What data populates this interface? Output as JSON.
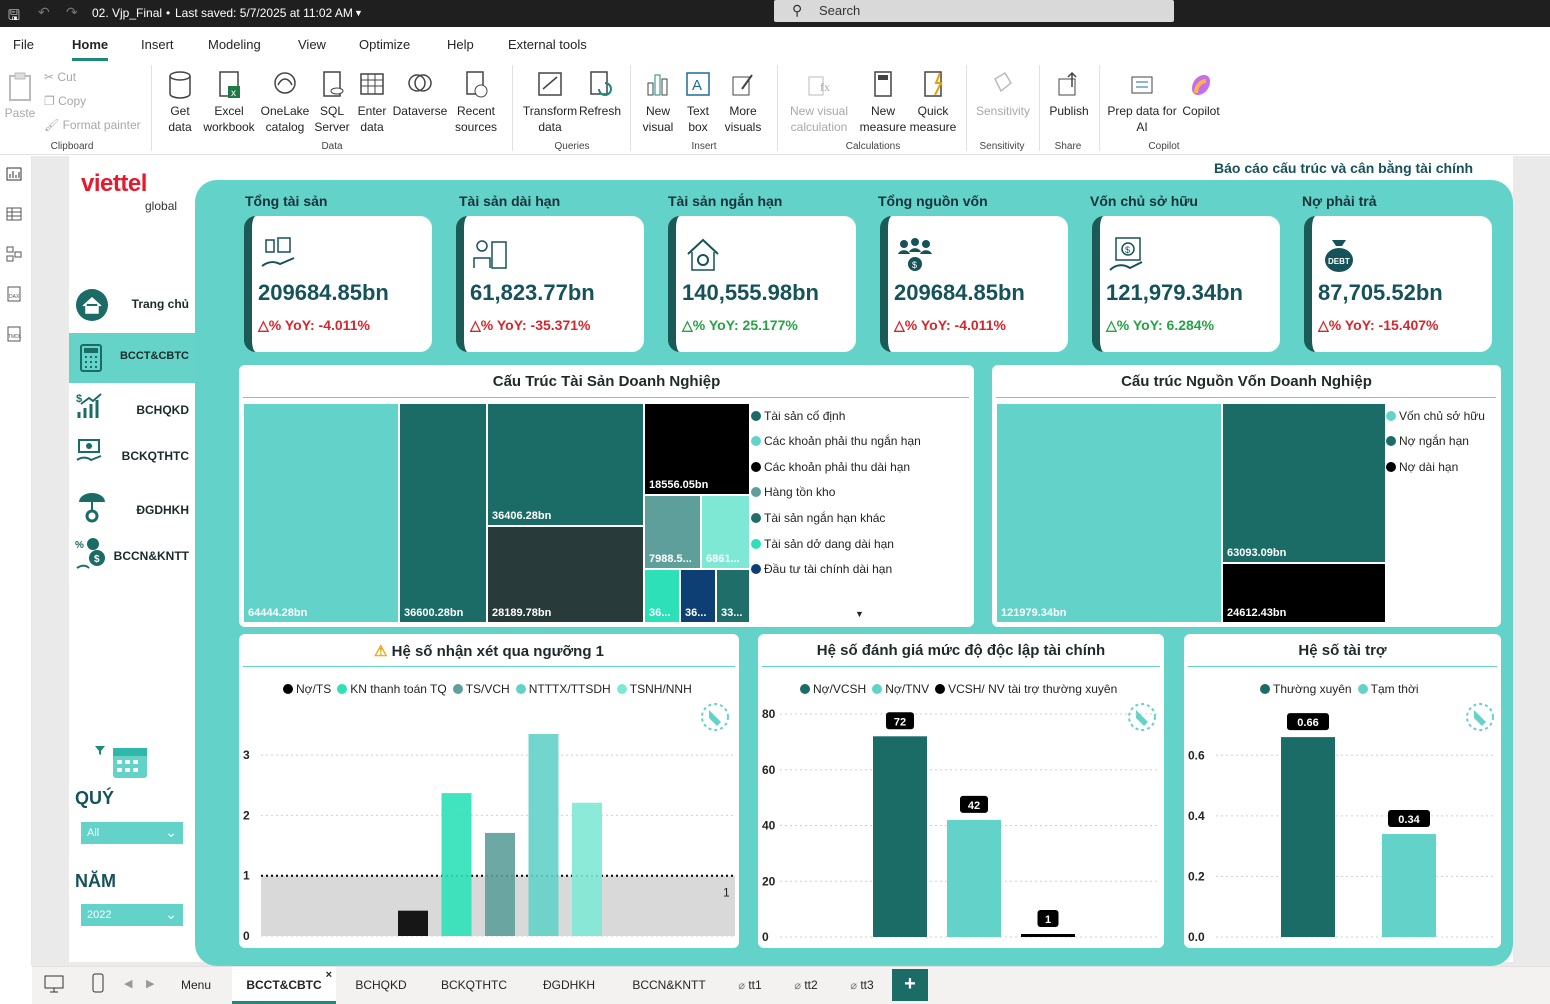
{
  "titlebar": {
    "filename": "02. Vjp_Final",
    "saved": "Last saved: 5/7/2025 at 11:02 AM",
    "search_placeholder": "Search"
  },
  "menu": [
    "File",
    "Home",
    "Insert",
    "Modeling",
    "View",
    "Optimize",
    "Help",
    "External tools"
  ],
  "ribbon": {
    "clipboard": {
      "paste": "Paste",
      "cut": "Cut",
      "copy": "Copy",
      "format_painter": "Format painter",
      "group": "Clipboard"
    },
    "data": {
      "get_data": "Get data",
      "excel": "Excel workbook",
      "onelake": "OneLake catalog",
      "sql": "SQL Server",
      "enter_data": "Enter data",
      "dataverse": "Dataverse",
      "recent": "Recent sources",
      "group": "Data"
    },
    "queries": {
      "transform": "Transform data",
      "refresh": "Refresh",
      "group": "Queries"
    },
    "insert": {
      "new_visual": "New visual",
      "text_box": "Text box",
      "more_visuals": "More visuals",
      "group": "Insert"
    },
    "calculations": {
      "new_visual_calc": "New visual calculation",
      "new_measure": "New measure",
      "quick_measure": "Quick measure",
      "group": "Calculations"
    },
    "sensitivity": {
      "label": "Sensitivity",
      "group": "Sensitivity"
    },
    "share": {
      "publish": "Publish",
      "group": "Share"
    },
    "copilot": {
      "prep": "Prep data for AI",
      "copilot": "Copilot",
      "group": "Copilot"
    }
  },
  "report": {
    "header_title": "Báo cáo cấu trúc và cân bằng tài chính",
    "logo": {
      "brand": "viettel",
      "sub": "global"
    },
    "nav": [
      {
        "label": "Trang chủ",
        "icon": "home-icon"
      },
      {
        "label": "BCCT&CBTC",
        "icon": "calculator-icon"
      },
      {
        "label": "BCHQKD",
        "icon": "growth-chart-icon"
      },
      {
        "label": "BCKQTHTC",
        "icon": "money-hand-icon"
      },
      {
        "label": "ĐGDHKH",
        "icon": "umbrella-gear-icon"
      },
      {
        "label": "BCCN&KNTT",
        "icon": "finance-people-icon"
      }
    ],
    "slicers": {
      "quarter_label": "QUÝ",
      "quarter_value": "All",
      "year_label": "NĂM",
      "year_value": "2022"
    },
    "kpis": [
      {
        "title": "Tổng tài sản",
        "value": "209684.85bn",
        "yoy": "△% YoY: -4.011%",
        "trend": "down"
      },
      {
        "title": "Tài sản dài hạn",
        "value": "61,823.77bn",
        "yoy": "△% YoY: -35.371%",
        "trend": "down"
      },
      {
        "title": "Tài sản ngắn hạn",
        "value": "140,555.98bn",
        "yoy": "△% YoY: 25.177%",
        "trend": "up"
      },
      {
        "title": "Tổng nguồn vốn",
        "value": "209684.85bn",
        "yoy": "△% YoY: -4.011%",
        "trend": "down"
      },
      {
        "title": "Vốn chủ sở hữu",
        "value": "121,979.34bn",
        "yoy": "△% YoY: 6.284%",
        "trend": "up"
      },
      {
        "title": "Nợ phải trả",
        "value": "87,705.52bn",
        "yoy": "△% YoY: -15.407%",
        "trend": "down"
      }
    ],
    "asset_treemap": {
      "title": "Cấu Trúc Tài Sản Doanh Nghiệp",
      "legend": [
        {
          "label": "Tài sản cố định",
          "color": "#1b6b67"
        },
        {
          "label": "Các khoản phải thu ngắn hạn",
          "color": "#63d2c8"
        },
        {
          "label": "Các khoản phải thu dài hạn",
          "color": "#000000"
        },
        {
          "label": "Hàng tồn kho",
          "color": "#5e9e9b"
        },
        {
          "label": "Tài sản ngắn hạn khác",
          "color": "#1f6e6a"
        },
        {
          "label": "Tài sản dở dang dài hạn",
          "color": "#2ee0b8"
        },
        {
          "label": "Đầu tư tài chính dài hạn",
          "color": "#0e3f74"
        }
      ],
      "tiles": [
        "64444.28bn",
        "36600.28bn",
        "36406.28bn",
        "28189.78bn",
        "18556.05bn",
        "7988.5...",
        "6861...",
        "36...",
        "36...",
        "33..."
      ]
    },
    "capital_treemap": {
      "title": "Cấu trúc Nguồn Vốn Doanh Nghiệp",
      "legend": [
        {
          "label": "Vốn chủ sở hữu",
          "color": "#63d2c8"
        },
        {
          "label": "Nợ ngắn hạn",
          "color": "#1b6b67"
        },
        {
          "label": "Nợ dài hạn",
          "color": "#000000"
        }
      ],
      "tiles": [
        "121979.34bn",
        "63093.09bn",
        "24612.43bn"
      ]
    },
    "chart1_title": "Hệ số nhận xét qua ngưỡng 1",
    "chart2_title": "Hệ số đánh giá mức độ độc lập tài chính",
    "chart3_title": "Hệ số tài trợ"
  },
  "chart_data": [
    {
      "type": "bar",
      "title": "Hệ số nhận xét qua ngưỡng 1",
      "categories": [
        "Nợ/TS",
        "KN thanh toán TQ",
        "TS/VCH",
        "NTTTX/TTSDH",
        "TSNH/NNH"
      ],
      "values": [
        0.42,
        2.37,
        1.71,
        3.35,
        2.21
      ],
      "colors": [
        "#000000",
        "#2ee0b8",
        "#5e9e9b",
        "#63d2c8",
        "#7fe8d4"
      ],
      "ylim": [
        0,
        3.4
      ],
      "yticks": [
        0,
        1,
        2,
        3
      ],
      "reference_line": {
        "value": 1,
        "label": "1"
      },
      "legend_position": "top"
    },
    {
      "type": "bar",
      "title": "Hệ số đánh giá mức độ độc lập tài chính",
      "categories": [
        "Nợ/VCSH",
        "Nợ/TNV",
        "VCSH/ NV tài trợ thường xuyên"
      ],
      "values": [
        72,
        42,
        1
      ],
      "data_labels": [
        "72",
        "42",
        "1"
      ],
      "colors": [
        "#1b6b67",
        "#63d2c8",
        "#000000"
      ],
      "ylim": [
        0,
        80
      ],
      "yticks": [
        0,
        20,
        40,
        60,
        80
      ],
      "legend_position": "top"
    },
    {
      "type": "bar",
      "title": "Hệ số tài trợ",
      "categories": [
        "Thường xuyên",
        "Tạm thời"
      ],
      "values": [
        0.66,
        0.34
      ],
      "data_labels": [
        "0.66",
        "0.34"
      ],
      "colors": [
        "#1b6b67",
        "#63d2c8"
      ],
      "ylim": [
        0,
        0.7
      ],
      "yticks": [
        "0.0",
        "0.2",
        "0.4",
        "0.6"
      ],
      "legend_position": "top"
    }
  ],
  "tabs": [
    "Menu",
    "BCCT&CBTC",
    "BCHQKD",
    "BCKQTHTC",
    "ĐGDHKH",
    "BCCN&KNTT",
    "tt1",
    "tt2",
    "tt3"
  ],
  "tab_add": "+"
}
